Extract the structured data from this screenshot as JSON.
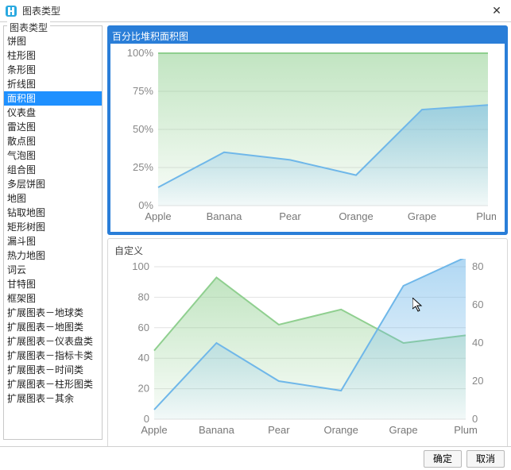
{
  "window": {
    "title": "图表类型",
    "close_glyph": "✕"
  },
  "sidebar": {
    "legend": "图表类型",
    "items": [
      "饼图",
      "柱形图",
      "条形图",
      "折线图",
      "面积图",
      "仪表盘",
      "雷达图",
      "散点图",
      "气泡图",
      "组合图",
      "多层饼图",
      "地图",
      "钻取地图",
      "矩形树图",
      "漏斗图",
      "热力地图",
      "词云",
      "甘特图",
      "框架图",
      "扩展图表－地球类",
      "扩展图表－地图类",
      "扩展图表－仪表盘类",
      "扩展图表－指标卡类",
      "扩展图表－时间类",
      "扩展图表－柱形图类",
      "扩展图表－其余"
    ],
    "selected_index": 4
  },
  "preview": {
    "cards": [
      {
        "title": "百分比堆积面积图",
        "selected": true
      },
      {
        "title": "自定义",
        "selected": false
      }
    ]
  },
  "footer": {
    "ok": "确定",
    "cancel": "取消"
  },
  "chart_data": [
    {
      "type": "area",
      "title": "百分比堆积面积图",
      "categories": [
        "Apple",
        "Banana",
        "Pear",
        "Orange",
        "Grape",
        "Plum"
      ],
      "ylabel": "",
      "ylim": [
        0,
        100
      ],
      "y_ticks": [
        "0%",
        "25%",
        "50%",
        "75%",
        "100%"
      ],
      "series": [
        {
          "name": "green",
          "color": "#8fcf8f",
          "values": [
            100,
            100,
            100,
            100,
            100,
            100
          ]
        },
        {
          "name": "blue",
          "color": "#6fb7e9",
          "values": [
            12,
            35,
            30,
            20,
            63,
            66
          ]
        }
      ]
    },
    {
      "type": "area",
      "title": "自定义",
      "categories": [
        "Apple",
        "Banana",
        "Pear",
        "Orange",
        "Grape",
        "Plum"
      ],
      "ylabel": "",
      "ylim": [
        0,
        100
      ],
      "y_ticks_left": [
        "0",
        "20",
        "40",
        "60",
        "80",
        "100"
      ],
      "y_ticks_right": [
        "0",
        "20",
        "40",
        "60",
        "80"
      ],
      "series": [
        {
          "name": "green",
          "axis": "left",
          "color": "#8fcf8f",
          "values": [
            45,
            93,
            62,
            72,
            50,
            55
          ]
        },
        {
          "name": "blue",
          "axis": "right",
          "color": "#6fb7e9",
          "values": [
            5,
            40,
            20,
            15,
            70,
            85
          ]
        }
      ]
    }
  ]
}
